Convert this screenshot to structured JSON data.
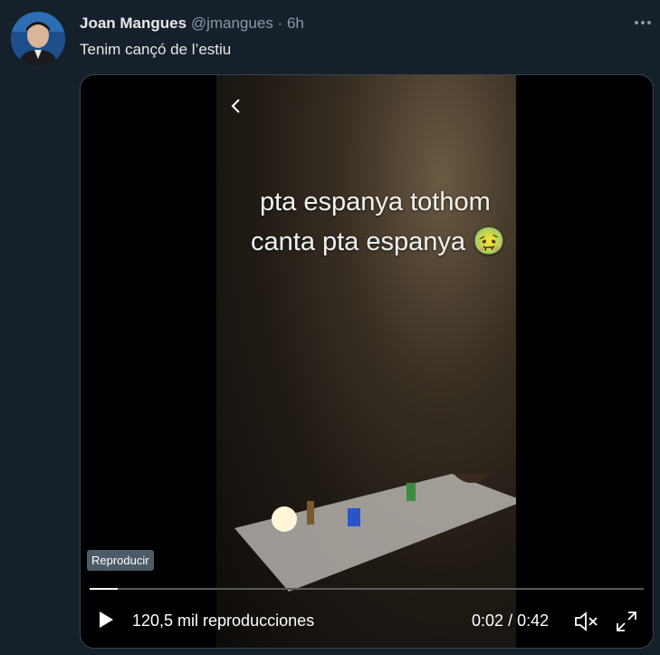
{
  "tweet": {
    "author_name": "Joan Mangues",
    "handle": "@jmangues",
    "separator": "·",
    "time": "6h",
    "text": "Tenim cançó de l’estiu",
    "avatar_icon": "user-avatar"
  },
  "menu": {
    "more_icon": "more-dots-icon"
  },
  "video": {
    "overlay_line1": "pta espanya tothom",
    "overlay_line2": "canta pta espanya 🤢",
    "tooltip": "Reproducir",
    "progress": 0.05,
    "views": "120,5 mil reproducciones",
    "current_time": "0:02",
    "time_separator": "/",
    "duration": "0:42",
    "icons": [
      "back-chevron-icon",
      "play-icon",
      "mute-icon",
      "fullscreen-icon"
    ]
  },
  "colors": {
    "background": "#15202b",
    "muted_text": "#8b98a5",
    "primary_text": "#e7e9ea",
    "media_border": "#38444d"
  }
}
